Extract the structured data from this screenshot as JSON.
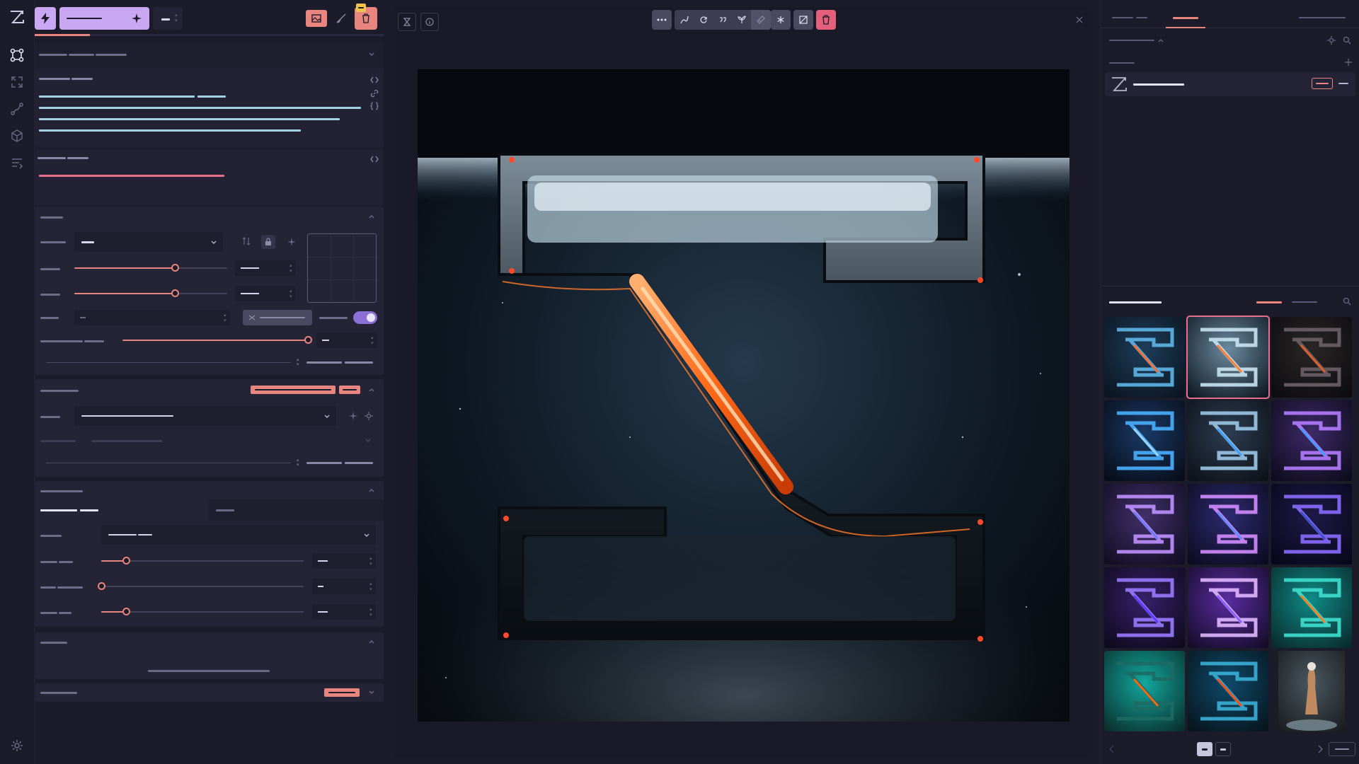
{
  "app": {
    "logo": "zeta-logo-icon",
    "settings_icon": "gear-icon"
  },
  "rail": {
    "items": [
      {
        "icon": "nodes-icon",
        "active": true
      },
      {
        "icon": "upscale-icon",
        "active": false
      },
      {
        "icon": "workflow-icon",
        "active": false
      },
      {
        "icon": "models-icon",
        "active": false
      },
      {
        "icon": "queue-icon",
        "active": false
      }
    ]
  },
  "toolbar": {
    "invoke_icon": "lightning-icon",
    "tabs": [
      {
        "icon": "image-icon",
        "active": true
      },
      {
        "icon": "brush-icon",
        "active": false
      },
      {
        "icon": "trash-icon",
        "danger": true
      }
    ]
  },
  "prompt": {
    "positive_icons": [
      "code-icon",
      "link-icon",
      "braces-icon"
    ],
    "negative_icon": "code-icon"
  },
  "canvas": {
    "tools": [
      "more-icon",
      "pencil-curve-icon",
      "refresh-icon",
      "quote-icon",
      "seedling-icon",
      "eraser-icon",
      "asterisk-icon",
      "crop-icon",
      "trash-icon"
    ],
    "left_tools": [
      "hourglass-icon",
      "info-icon"
    ],
    "close_icon": "close-icon"
  },
  "gallery": {
    "thumbnails": [
      {
        "theme": "blue-ship",
        "selected": false
      },
      {
        "theme": "blue-neon",
        "selected": true
      },
      {
        "theme": "dark-red",
        "selected": false
      },
      {
        "theme": "blue-glow",
        "selected": false
      },
      {
        "theme": "blue-station",
        "selected": false
      },
      {
        "theme": "purple-ring",
        "selected": false
      },
      {
        "theme": "purple-nebula",
        "selected": false
      },
      {
        "theme": "purple-vortex",
        "selected": false
      },
      {
        "theme": "purple-dark",
        "selected": false
      },
      {
        "theme": "purple-planet",
        "selected": false
      },
      {
        "theme": "violet-streak",
        "selected": false
      },
      {
        "theme": "teal-lava",
        "selected": false
      },
      {
        "theme": "teal-fire",
        "selected": false
      },
      {
        "theme": "lava-sea",
        "selected": false
      },
      {
        "theme": "figure",
        "selected": false
      }
    ]
  },
  "colors": {
    "accent": "#c9a7f2",
    "salmon": "#e8857f",
    "danger": "#e4607a",
    "bg": "#1c1b29",
    "panel": "#252436"
  }
}
